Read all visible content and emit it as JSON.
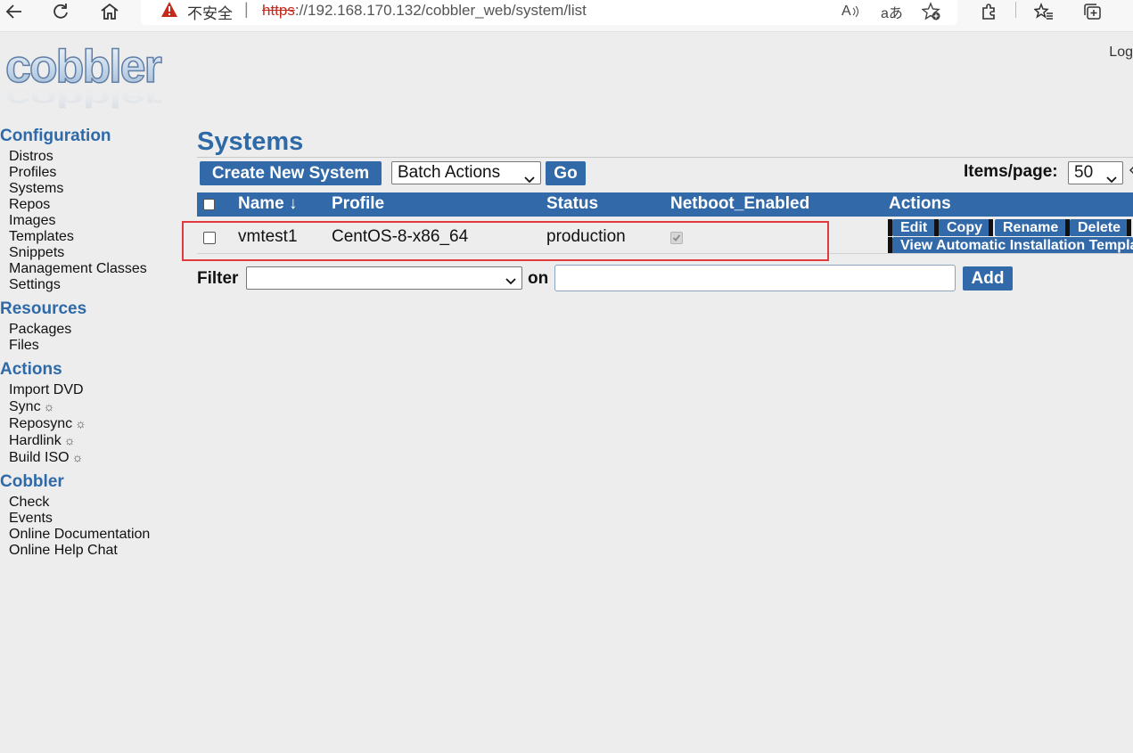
{
  "browser": {
    "insecure_label": "不安全",
    "separator": "|",
    "url_scheme": "https",
    "url_rest": "://192.168.170.132/cobbler_web/system/list",
    "read_aloud": "A",
    "translate": "aあ"
  },
  "header": {
    "logo_text": "cobbler",
    "logout": "Log"
  },
  "sidebar": {
    "configuration": {
      "title": "Configuration",
      "items": [
        "Distros",
        "Profiles",
        "Systems",
        "Repos",
        "Images",
        "Templates",
        "Snippets",
        "Management Classes",
        "Settings"
      ]
    },
    "resources": {
      "title": "Resources",
      "items": [
        "Packages",
        "Files"
      ]
    },
    "actions": {
      "title": "Actions",
      "items": [
        "Import DVD",
        "Sync",
        "Reposync",
        "Hardlink",
        "Build ISO"
      ],
      "gear": "☼"
    },
    "cobbler": {
      "title": "Cobbler",
      "items": [
        "Check",
        "Events",
        "Online Documentation",
        "Online Help Chat"
      ]
    }
  },
  "main": {
    "title": "Systems",
    "create_button": "Create New System",
    "batch_actions": "Batch Actions",
    "go_button": "Go",
    "items_per_page_label": "Items/page:",
    "items_per_page_value": "50",
    "table": {
      "columns": [
        "Name ↓",
        "Profile",
        "Status",
        "Netboot_Enabled",
        "Actions"
      ],
      "rows": [
        {
          "name": "vmtest1",
          "profile": "CentOS-8-x86_64",
          "status": "production",
          "netboot_enabled": true,
          "actions": [
            "Edit",
            "Copy",
            "Rename",
            "Delete",
            "View Automatic Installation Templa"
          ]
        }
      ]
    },
    "filter_label": "Filter",
    "on_label": "on",
    "add_button": "Add"
  },
  "colors": {
    "accent": "#3169a9",
    "heading": "#2f6aa8",
    "highlight_box": "#e0393e",
    "page_bg": "#ededed"
  }
}
